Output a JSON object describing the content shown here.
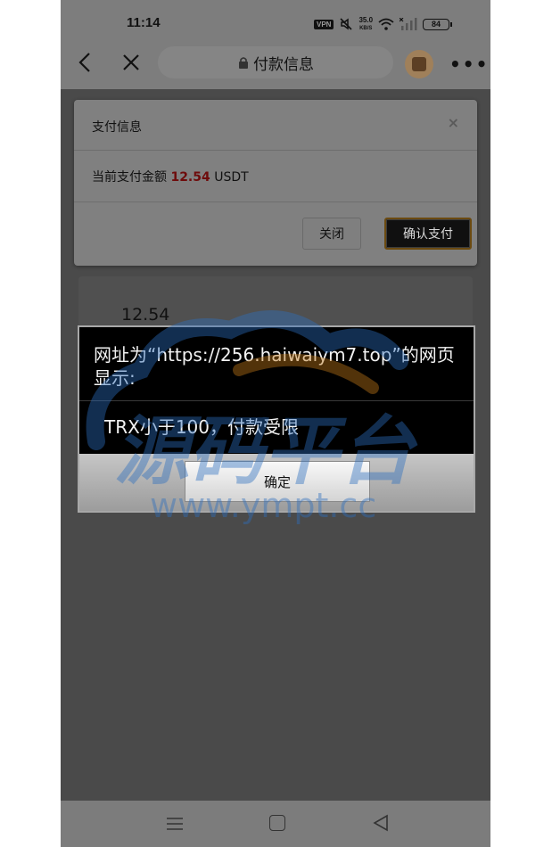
{
  "status_bar": {
    "time": "11:14",
    "vpn": "VPN",
    "speed_value": "35.0",
    "speed_unit": "KB/S",
    "battery": "84",
    "icons": [
      "vpn-icon",
      "mute-icon",
      "wifi-icon",
      "signal-icon",
      "battery-icon"
    ]
  },
  "nav": {
    "title": "付款信息",
    "icons": [
      "back-icon",
      "close-icon",
      "lock-icon",
      "avatar",
      "more-icon"
    ]
  },
  "payment_card": {
    "title": "支付信息",
    "close_symbol": "×",
    "amount_label": "当前支付金额",
    "amount_value": "12.54",
    "currency": "USDT",
    "close_button": "关闭",
    "confirm_button": "确认支付"
  },
  "lower_card": {
    "amount": "12.54"
  },
  "watermark": {
    "text_cn": "源码平台",
    "text_url": "www.ympt.cc"
  },
  "alert": {
    "title": "网址为“https://256.haiwaiym7.top”的网页显示:",
    "message": "TRX小于100，付款受限",
    "ok_button": "确定"
  },
  "system_nav": {
    "icons": [
      "menu-icon",
      "home-icon",
      "back-triangle-icon"
    ]
  },
  "colors": {
    "amount_red": "#6e0c0c",
    "overlay_gray": "#7d7d7d",
    "alert_black": "#000000"
  }
}
